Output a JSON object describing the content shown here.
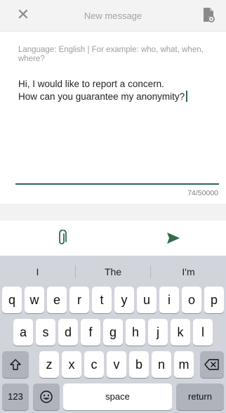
{
  "header": {
    "title": "New message"
  },
  "compose": {
    "hint": "Language: English | For example: who, what, when, where?",
    "message_line1": "Hi, I would like to report a concern.",
    "message_line2": "How can you guarantee my anonymity?",
    "counter": "74/50000"
  },
  "icons": {
    "close": "close-icon",
    "document": "document-settings-icon",
    "attach": "paperclip-icon",
    "send": "send-icon",
    "shift": "shift-icon",
    "backspace": "backspace-icon",
    "emoji": "emoji-icon"
  },
  "colors": {
    "accent": "#2f6c4d",
    "keyboard_bg": "#d1d4db",
    "function_key": "#aeb3bc"
  },
  "keyboard": {
    "suggestions": [
      "I",
      "The",
      "I'm"
    ],
    "row1": [
      "q",
      "w",
      "e",
      "r",
      "t",
      "y",
      "u",
      "i",
      "o",
      "p"
    ],
    "row2": [
      "a",
      "s",
      "d",
      "f",
      "g",
      "h",
      "j",
      "k",
      "l"
    ],
    "row3": [
      "z",
      "x",
      "c",
      "v",
      "b",
      "n",
      "m"
    ],
    "numbers": "123",
    "space": "space",
    "return": "return"
  }
}
